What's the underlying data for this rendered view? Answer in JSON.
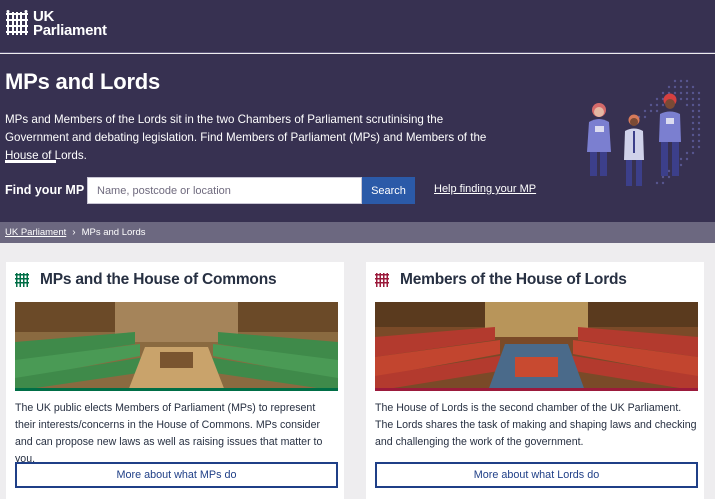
{
  "header": {
    "logo": {
      "line1": "UK",
      "line2": "Parliament",
      "icon": "portcullis-icon"
    }
  },
  "hero": {
    "title": "MPs and Lords",
    "description": "MPs and Members of the Lords sit in the two Chambers of Parliament scrutinising the Government and debating legislation. Find Members of Parliament (MPs) and Members of the House of Lords.",
    "find_label": "Find your MP",
    "search_placeholder": "Name, postcode or location",
    "search_button": "Search",
    "help_link": "Help finding your MP",
    "illustration": "three-members-illustration"
  },
  "breadcrumb": {
    "items": [
      "UK Parliament",
      "MPs and Lords"
    ]
  },
  "cards": [
    {
      "title": "MPs and the House of Commons",
      "icon": "commons-portcullis-icon",
      "image": "house-of-commons-chamber",
      "body": "The UK public elects Members of Parliament (MPs) to represent their interests/concerns in the House of Commons. MPs consider and can propose new laws as well as raising issues that matter to you.",
      "button": "More about what MPs do",
      "accent": "#006e46"
    },
    {
      "title": "Members of the House of Lords",
      "icon": "lords-portcullis-icon",
      "image": "house-of-lords-chamber",
      "body": "The House of Lords is the second chamber of the UK Parliament. The Lords shares the task of making and shaping laws and checking and challenging the work of the government.",
      "button": "More about what Lords do",
      "accent": "#9b1a3b"
    }
  ],
  "colors": {
    "header_bg": "#373151",
    "breadcrumb_bg": "#6c6880",
    "search_button": "#2b5aa8",
    "link_blue": "#1f3f87",
    "commons_green": "#006e46",
    "lords_red": "#9b1a3b"
  }
}
